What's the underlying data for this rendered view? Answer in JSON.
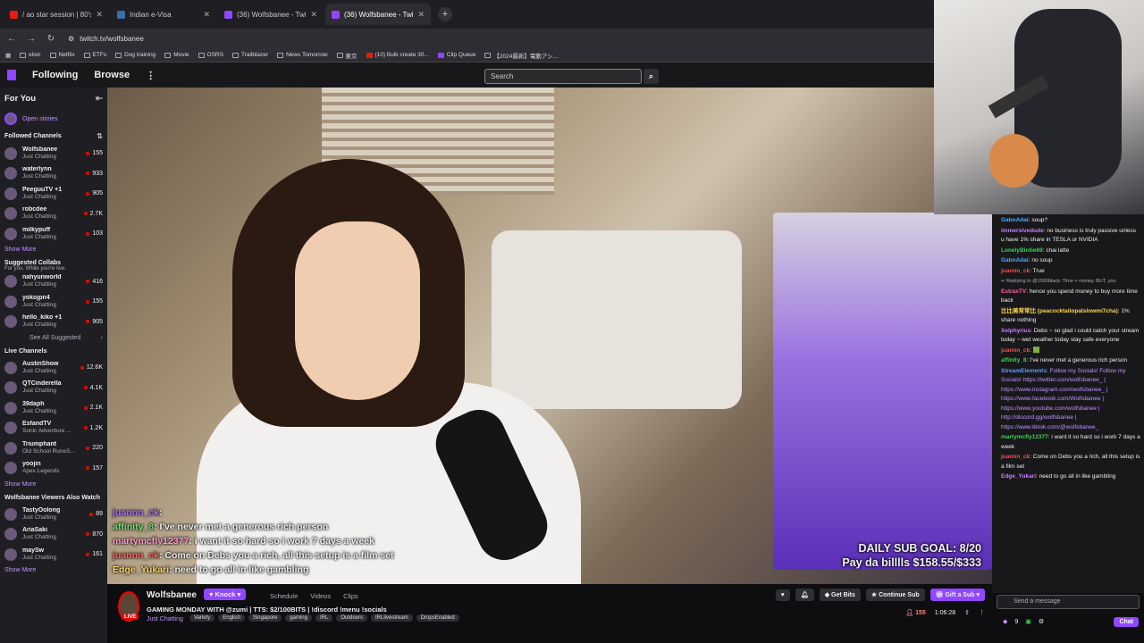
{
  "browser": {
    "tabs": [
      {
        "title": "/ ao star session | 80's Toki",
        "color": "#e91916"
      },
      {
        "title": "Indian e-Visa",
        "color": "#3a6ea5"
      },
      {
        "title": "(36) Wolfsbanee - Twitch",
        "color": "#9147ff"
      },
      {
        "title": "(36) Wolfsbanee - Twitch",
        "color": "#9147ff"
      }
    ],
    "url": "twitch.tv/wolfsbanee",
    "bookmarks": [
      "elixir",
      "Netflix",
      "ETFs",
      "Dog training",
      "Movie",
      "OSRS",
      "Trailblazer",
      "News Tomorrow",
      "東京",
      "(10) Bulk create 30...",
      "Clip Queue",
      "【2024最新】電動アシ..."
    ]
  },
  "topnav": {
    "following": "Following",
    "browse": "Browse",
    "more": "⋮",
    "search_placeholder": "Search"
  },
  "sidebar": {
    "for_you": "For You",
    "open_stories": "Open stories",
    "followed_title": "Followed Channels",
    "followed": [
      {
        "name": "Wolfsbanee",
        "game": "Just Chatting",
        "viewers": "155"
      },
      {
        "name": "waterlynn",
        "game": "Just Chatting",
        "viewers": "933"
      },
      {
        "name": "PeeguuTV +1",
        "game": "Just Chatting",
        "viewers": "905"
      },
      {
        "name": "robcdee",
        "game": "Just Chatting",
        "viewers": "2.7K"
      },
      {
        "name": "milkypuff",
        "game": "Just Chatting",
        "viewers": "103"
      }
    ],
    "show_more": "Show More",
    "suggested_title": "Suggested Collabs",
    "suggested_sub": "For you. While you're live.",
    "suggested": [
      {
        "name": "nahyunworld",
        "game": "Just Chatting",
        "viewers": "416"
      },
      {
        "name": "yokojpn4",
        "game": "Just Chatting",
        "viewers": "155"
      },
      {
        "name": "hello_kiko +1",
        "game": "Just Chatting",
        "viewers": "905"
      }
    ],
    "see_all": "See All Suggested",
    "live_title": "Live Channels",
    "live": [
      {
        "name": "AustinShow",
        "game": "Just Chatting",
        "viewers": "12.6K"
      },
      {
        "name": "QTCinderella",
        "game": "Just Chatting",
        "viewers": "4.1K"
      },
      {
        "name": "39daph",
        "game": "Just Chatting",
        "viewers": "2.1K"
      },
      {
        "name": "EsfandTV",
        "game": "Sonic Adventure ...",
        "viewers": "1.2K"
      },
      {
        "name": "Triumphant",
        "game": "Old School RuneS...",
        "viewers": "220"
      },
      {
        "name": "yoojin",
        "game": "Apex Legends",
        "viewers": "157"
      }
    ],
    "also_title": "Wolfsbanee Viewers Also Watch",
    "also": [
      {
        "name": "TastyOolong",
        "game": "Just Chatting",
        "viewers": "89"
      },
      {
        "name": "AriaSaki",
        "game": "Just Chatting",
        "viewers": "870"
      },
      {
        "name": "maySw",
        "game": "Just Chatting",
        "viewers": "161"
      }
    ]
  },
  "overlay": {
    "chat": [
      {
        "user": "juannn_ck",
        "msg": ""
      },
      {
        "user": "affinity_8",
        "msg": "I've never met a generous rich person"
      },
      {
        "user": "martymcfly12377",
        "msg": "i want it so hard so i work 7 days a week"
      },
      {
        "user": "juannn_ck",
        "msg": "Come on Debs you a rich, all this setup is a film set"
      },
      {
        "user": "Edge_Yukari",
        "msg": "need to go all in like gambling"
      }
    ],
    "goal": "DAILY SUB GOAL: 8/20",
    "pay": "Pay da billlls $158.55/$333"
  },
  "chat": {
    "messages": [
      {
        "user": "GaboAdai",
        "color": "#4ea7ff",
        "msg": "soup?"
      },
      {
        "user": "immersivedude",
        "color": "#c77dff",
        "msg": "no business is truly passive unless u have 1% share in TESLA or NVIDIA"
      },
      {
        "user": "LonelyBirdie69",
        "color": "#39d353",
        "msg": "chai latte"
      },
      {
        "user": "GaboAdai",
        "color": "#4ea7ff",
        "msg": "no soup"
      },
      {
        "user": "juannn_ck",
        "color": "#ff4d4d",
        "msg": "True"
      },
      {
        "user": "",
        "color": "#adadb8",
        "msg": "Replying to @1500black: Time + money. BUT, you"
      },
      {
        "user": "EstraxTV",
        "color": "#ff5fa2",
        "msg": "hence you spend money to buy more time back"
      },
      {
        "user": "比比美常常比 (peacocktailopalslowmi7cha)",
        "color": "#ffd84d",
        "msg": "1% share nothing"
      },
      {
        "user": "Xelphyrius",
        "color": "#c77dff",
        "msg": "Debs ~ so glad i could catch your stream today ~ wet weather today stay safe everyone"
      },
      {
        "user": "juannn_ck",
        "color": "#ff4d4d",
        "msg": ""
      },
      {
        "user": "affinity_8",
        "color": "#39d353",
        "msg": "I've never met a generous rich person"
      },
      {
        "user": "StreamElements",
        "color": "#5b9dff",
        "msg": "Follow my Socials! Follow my Socials!"
      },
      {
        "user": "",
        "color": "#bf94ff",
        "msg": "https://twitter.com/wolfsbanee_ | https://www.instagram.com/wolfsbanee_ | https://www.facebook.com/Wolfsbanee | https://www.youtube.com/wolfsbanee | http://discord.gg/wolfsbanee | https://www.tiktok.com/@wolfsbanee_"
      },
      {
        "user": "martymcfly12377",
        "color": "#39d353",
        "msg": "i want it so hard so i work 7 days a week"
      },
      {
        "user": "juannn_ck",
        "color": "#ff4d4d",
        "msg": "Come on Debs you a rich, all this setup is a film set"
      },
      {
        "user": "Edge_Yukari",
        "color": "#c77dff",
        "msg": "need to go all in like gambling"
      }
    ],
    "placeholder": "Send a message",
    "points": "9",
    "chat_button": "Chat"
  },
  "stream": {
    "name": "Wolfsbanee",
    "knock": "Knock",
    "tabs": [
      "Schedule",
      "Videos",
      "Clips"
    ],
    "title": "GAMING MONDAY WITH @zumi | TTS: $2/100BITS | !discord !menu !socials",
    "category": "Just Chatting",
    "tags": [
      "Variety",
      "English",
      "Singapore",
      "gaming",
      "IRL",
      "Outdoors",
      "IRLlivestream",
      "DropsEnabled"
    ],
    "live": "LIVE",
    "get_bits": "Get Bits",
    "continue_sub": "Continue Sub",
    "gift_sub": "Gift a Sub",
    "viewers": "155",
    "uptime": "1:06:28"
  }
}
